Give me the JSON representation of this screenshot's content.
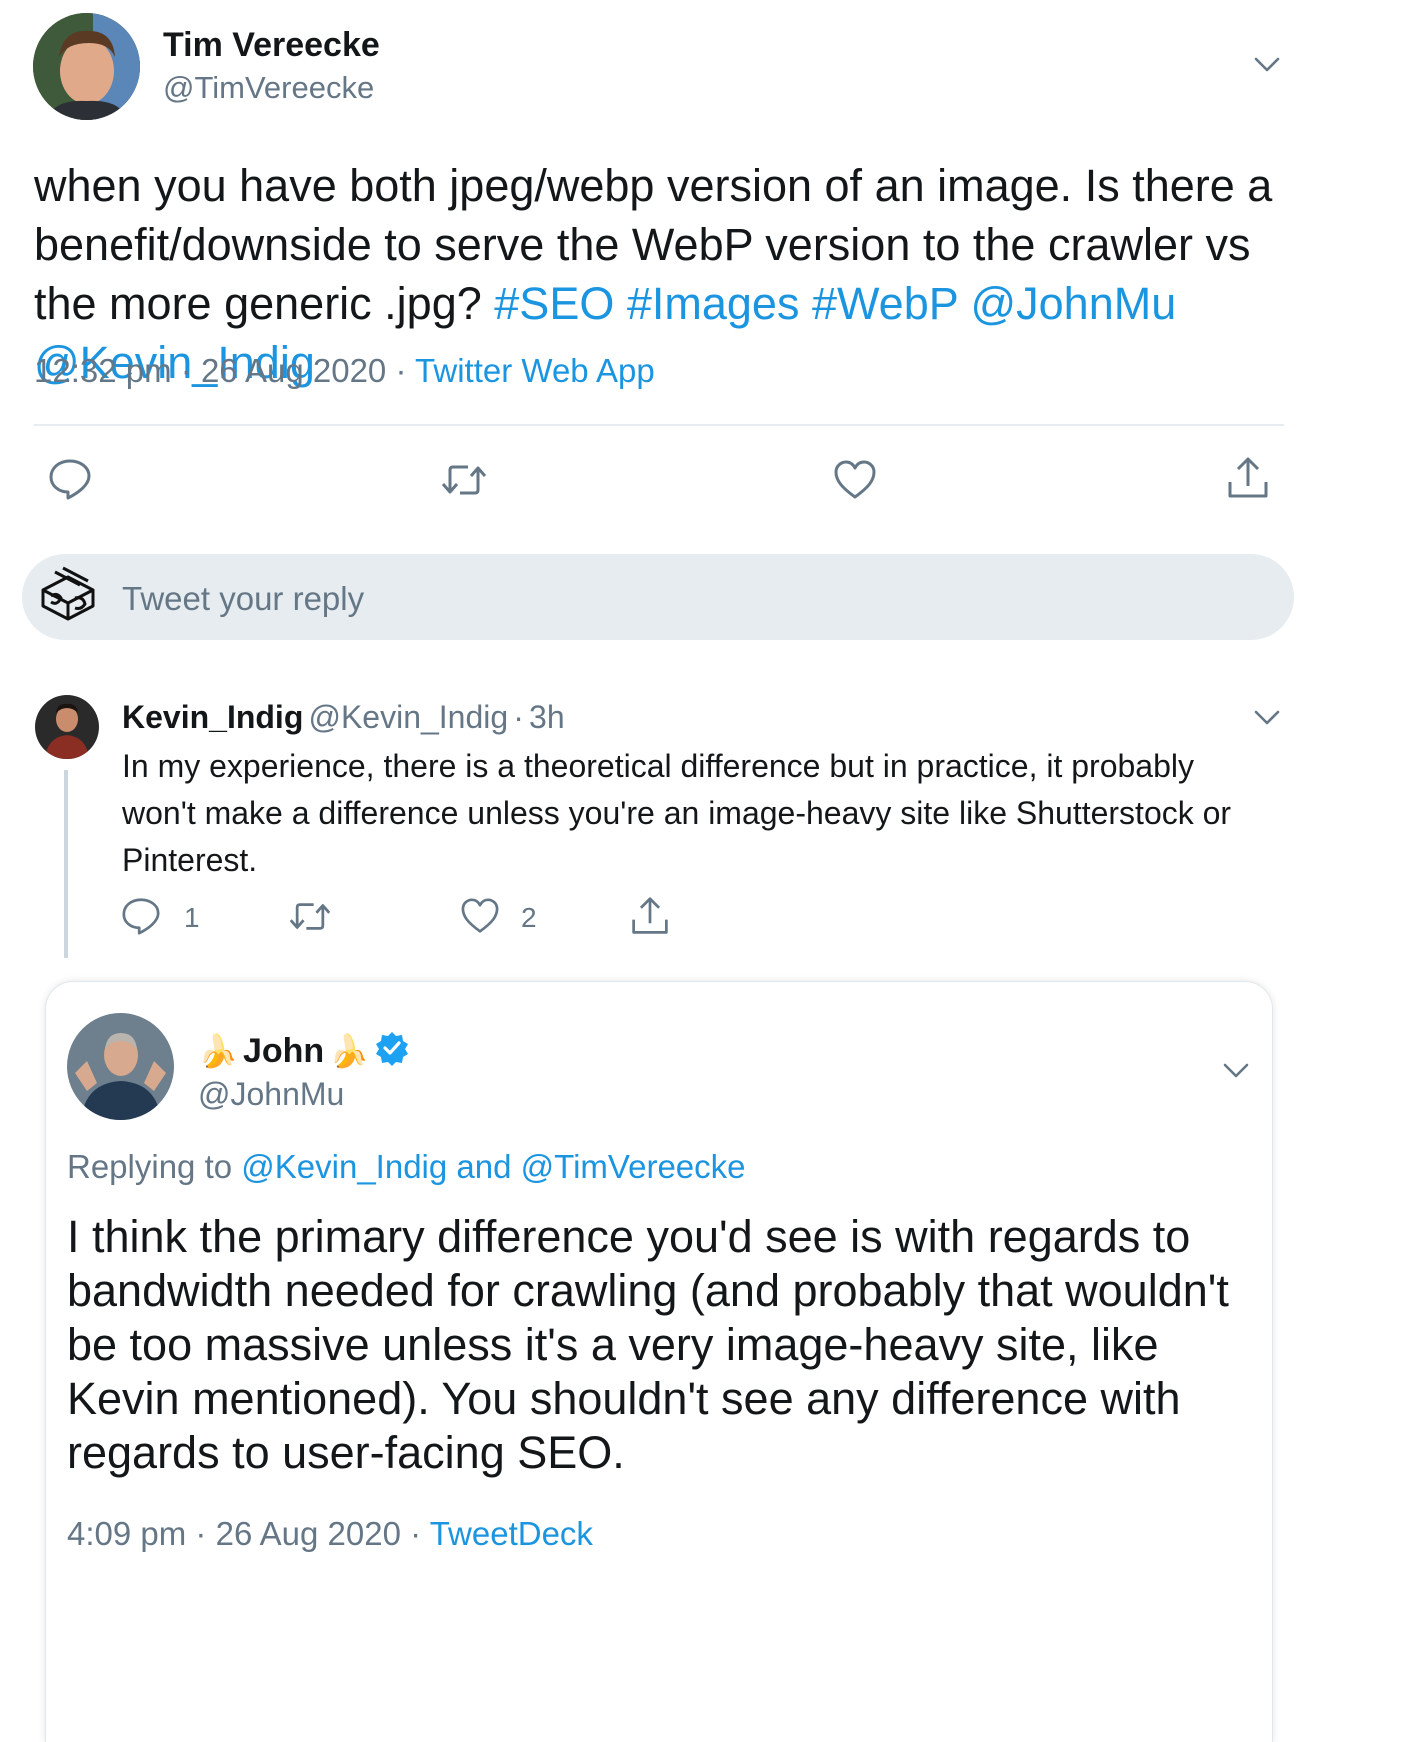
{
  "main_tweet": {
    "author_name": "Tim Vereecke",
    "author_handle": "@TimVereecke",
    "text": "when you have both jpeg/webp version of an image. Is there a benefit/downside to serve the WebP version to the crawler vs the more generic .jpg?",
    "hashtags": [
      "#SEO",
      "#Images",
      "#WebP"
    ],
    "mentions": [
      "@JohnMu",
      "@Kevin_Indig"
    ],
    "time": "12:32 pm",
    "date": "26 Aug 2020",
    "source": "Twitter Web App",
    "separator": "·"
  },
  "actions": {
    "reply_icon": "comment-icon",
    "retweet_icon": "retweet-icon",
    "like_icon": "heart-icon",
    "share_icon": "share-icon"
  },
  "reply_composer": {
    "placeholder": "Tweet your reply",
    "avatar_icon": "user-avatar-logo"
  },
  "reply_tweet": {
    "author_name": "Kevin_Indig",
    "author_handle": "@Kevin_Indig",
    "age": "3h",
    "separator": "·",
    "text": "In my experience, there is a theoretical difference but in practice, it probably won't make a difference unless you're an image-heavy site like Shutterstock or Pinterest.",
    "reply_count": "1",
    "like_count": "2"
  },
  "john_tweet": {
    "name_emoji": "🍌",
    "author_name": "John",
    "author_handle": "@JohnMu",
    "replying_prefix": "Replying to",
    "replying_to_1": "@Kevin_Indig",
    "replying_and": "and",
    "replying_to_2": "@TimVereecke",
    "text": "I think the primary difference you'd see is with regards to bandwidth needed for crawling (and probably that wouldn't be too massive unless it's a very image-heavy site, like Kevin mentioned). You shouldn't see any difference with regards to user-facing SEO.",
    "time": "4:09 pm",
    "date": "26 Aug 2020",
    "source": "TweetDeck",
    "separator": "·"
  },
  "colors": {
    "link_blue": "#1b95e0",
    "secondary_grey": "#657786",
    "divider": "#e6ecf0",
    "verified_blue": "#1da1f2"
  }
}
